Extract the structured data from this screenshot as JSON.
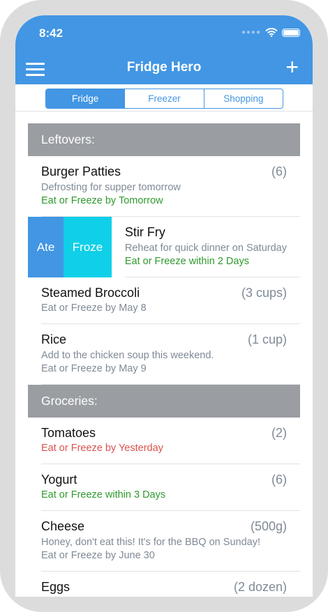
{
  "status": {
    "time": "8:42"
  },
  "nav": {
    "title": "Fridge Hero"
  },
  "tabs": [
    "Fridge",
    "Freezer",
    "Shopping"
  ],
  "sections": [
    {
      "title": "Leftovers:",
      "items": [
        {
          "name": "Burger Patties",
          "qty": "(6)",
          "note": "Defrosting for supper tomorrow",
          "expiry": "Eat or Freeze by Tomorrow"
        },
        {
          "name": "Stir Fry",
          "qty": "",
          "note": "Reheat for quick dinner on Saturday",
          "expiry": "Eat or Freeze within 2 Days"
        },
        {
          "name": "Steamed Broccoli",
          "qty": "(3 cups)",
          "expiry": "Eat or Freeze by May 8"
        },
        {
          "name": "Rice",
          "qty": "(1 cup)",
          "note": "Add to the chicken soup this weekend.",
          "expiry": "Eat or Freeze by May 9"
        }
      ]
    },
    {
      "title": "Groceries:",
      "items": [
        {
          "name": "Tomatoes",
          "qty": "(2)",
          "expiry": "Eat or Freeze by Yesterday"
        },
        {
          "name": "Yogurt",
          "qty": "(6)",
          "expiry": "Eat or Freeze within 3 Days"
        },
        {
          "name": "Cheese",
          "qty": "(500g)",
          "note": "Honey, don't eat this! It's for the BBQ on Sunday!",
          "expiry": "Eat or Freeze by June 30"
        },
        {
          "name": "Eggs",
          "qty": "(2 dozen)"
        }
      ]
    }
  ],
  "swipe_actions": {
    "ate": "Ate",
    "froze": "Froze"
  },
  "colors": {
    "primary": "#4296e3",
    "froze": "#0fd0e8",
    "ok": "#2e9a2e",
    "expired": "#d9534f",
    "header": "#9a9ea3"
  }
}
